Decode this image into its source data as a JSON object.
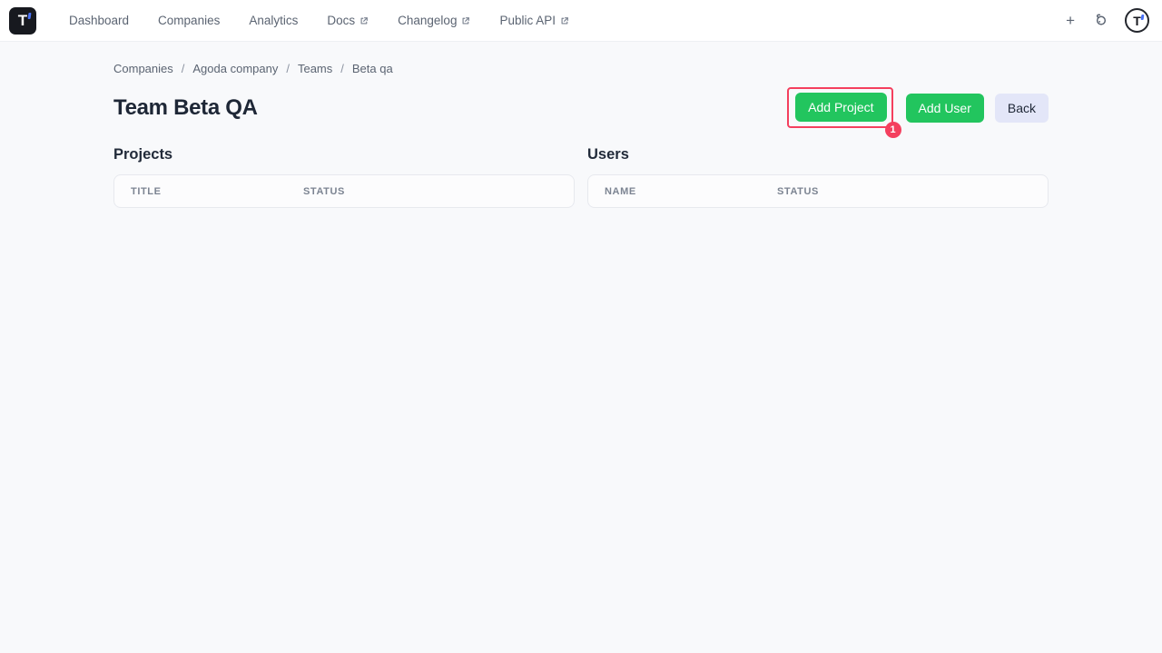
{
  "navbar": {
    "logo_letter": "T",
    "items": [
      {
        "label": "Dashboard",
        "external": false
      },
      {
        "label": "Companies",
        "external": false
      },
      {
        "label": "Analytics",
        "external": false
      },
      {
        "label": "Docs",
        "external": true
      },
      {
        "label": "Changelog",
        "external": true
      },
      {
        "label": "Public API",
        "external": true
      }
    ],
    "plus_label": "+"
  },
  "breadcrumb": {
    "separator": "/",
    "items": [
      "Companies",
      "Agoda company",
      "Teams",
      "Beta qa"
    ]
  },
  "page": {
    "title": "Team Beta QA"
  },
  "actions": {
    "add_project_label": "Add Project",
    "add_user_label": "Add User",
    "back_label": "Back",
    "annotation_badge": "1"
  },
  "projects": {
    "heading": "Projects",
    "columns": [
      "Title",
      "Status"
    ],
    "rows": []
  },
  "users": {
    "heading": "Users",
    "columns": [
      "Name",
      "Status"
    ],
    "rows": []
  },
  "colors": {
    "accent_green": "#22c55e",
    "annotation_red": "#f43f5e",
    "back_button_bg": "#e3e6f8",
    "logo_accent_blue": "#4a72f5"
  }
}
